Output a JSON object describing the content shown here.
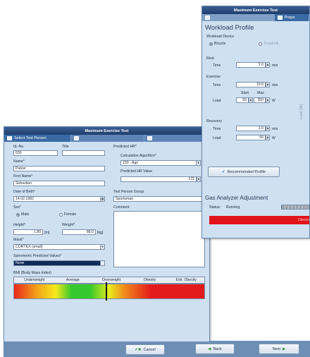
{
  "back_window": {
    "title": "Maximum Exercise Test",
    "tabs": [
      "Select Test Person",
      "",
      ""
    ],
    "left": {
      "id_no_label": "Id.-No.",
      "id_no_value": "030",
      "title_label": "Title",
      "title_value": "",
      "name_label": "Name*",
      "name_value": "Patzer",
      "first_name_label": "First Name*",
      "first_name_value": "Sebastian",
      "dob_label": "Date of Birth*",
      "dob_value": "14.02.1982",
      "sex_label": "Sex*",
      "sex_male": "Male",
      "sex_female": "Female",
      "height_label": "Height*",
      "height_value": "1.80",
      "height_unit": "[m]",
      "weight_label": "Weight*",
      "weight_value": "88.0",
      "weight_unit": "[kg]",
      "mask_label": "Mask*",
      "mask_value": "CORTEX (small)",
      "spiro_label": "Spirometric Predicted Values*",
      "spiro_value": "None"
    },
    "right": {
      "predicted_hr_label": "Predicted HR*",
      "calc_algo_label": "Calculation Algorithm*",
      "calc_algo_value": "220 - Age",
      "pred_hr_value_label": "Predicted HR Value",
      "pred_hr_value": "172",
      "group_label": "Test Person Group",
      "group_value": "Sportsman",
      "comment_label": "Comment"
    },
    "bmi": {
      "title": "BMI (Body Mass Index)",
      "categories": [
        "Underweight",
        "Average",
        "Overweight",
        "Obesity",
        "Extr. Obesity"
      ]
    },
    "footer": {
      "cancel_label": "Cancel",
      "back_label": "Back",
      "next_label": "Next"
    }
  },
  "front_window": {
    "title": "Maximum Exercise Test",
    "tab_label": "Prepa",
    "heading": "Workload Profile",
    "device_group": "Workload Device",
    "device_bicycle": "Bicycle",
    "device_treadmill": "Treadmill",
    "rest": {
      "label": "Rest",
      "time_label": "Time",
      "time_value": "2.0",
      "time_unit": "min"
    },
    "exercise": {
      "label": "Exercise",
      "time_label": "Time",
      "time_value": "10.0",
      "time_unit": "min",
      "start_label": "Start",
      "max_label": "Max",
      "load_label": "Load",
      "start_value": "50",
      "max_value": "350",
      "load_unit": "W"
    },
    "recovery": {
      "label": "Recovery",
      "time_label": "Time",
      "time_value": "2.0",
      "time_unit": "min",
      "load_label": "Load",
      "load_value": "50",
      "load_unit": "W"
    },
    "side_axis_label": "Load [W]",
    "recommended_label": "Recommended Profile",
    "gas_heading": "Gas Analyzer Adjustment",
    "status_label": "Status:",
    "status_value": "Running",
    "alert_text": "Discon",
    "colors": {
      "alert": "#e2141b",
      "titlebar": "#1f3d6c",
      "window_bg": "#cfe0f1"
    }
  }
}
